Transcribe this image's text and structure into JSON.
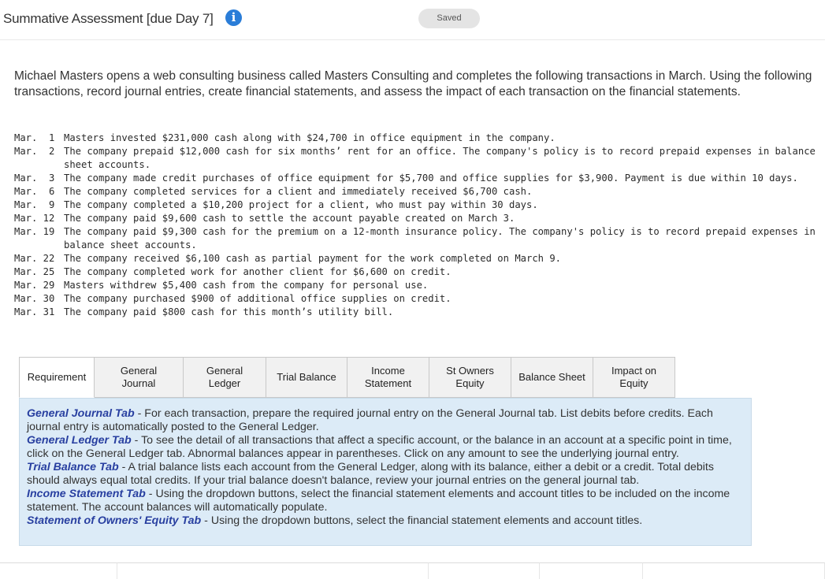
{
  "header": {
    "title": "Summative Assessment [due Day 7]",
    "info_icon": "i",
    "saved_label": "Saved"
  },
  "intro": "Michael Masters opens a web consulting business called Masters Consulting and completes the following transactions in March. Using the following transactions, record journal entries, create financial statements, and assess the impact of each transaction on the financial statements.",
  "transactions": [
    {
      "date": "Mar.  1",
      "text": "Masters invested $231,000 cash along with $24,700 in office equipment in the company."
    },
    {
      "date": "Mar.  2",
      "text": "The company prepaid $12,000 cash for six months’ rent for an office. The company's policy is to record prepaid expenses in balance sheet accounts."
    },
    {
      "date": "Mar.  3",
      "text": "The company made credit purchases of office equipment for $5,700 and office supplies for $3,900. Payment is due within 10 days."
    },
    {
      "date": "Mar.  6",
      "text": "The company completed services for a client and immediately received $6,700 cash."
    },
    {
      "date": "Mar.  9",
      "text": "The company completed a $10,200 project for a client, who must pay within 30 days."
    },
    {
      "date": "Mar. 12",
      "text": "The company paid $9,600 cash to settle the account payable created on March 3."
    },
    {
      "date": "Mar. 19",
      "text": "The company paid $9,300 cash for the premium on a 12-month insurance policy. The company's policy is to record prepaid expenses in balance sheet accounts."
    },
    {
      "date": "Mar. 22",
      "text": "The company received $6,100 cash as partial payment for the work completed on March 9."
    },
    {
      "date": "Mar. 25",
      "text": "The company completed work for another client for $6,600 on credit."
    },
    {
      "date": "Mar. 29",
      "text": "Masters withdrew $5,400 cash from the company for personal use."
    },
    {
      "date": "Mar. 30",
      "text": "The company purchased $900 of additional office supplies on credit."
    },
    {
      "date": "Mar. 31",
      "text": "The company paid $800 cash for this month’s utility bill."
    }
  ],
  "tabs": [
    {
      "line1": "Requirement",
      "line2": ""
    },
    {
      "line1": "General",
      "line2": "Journal"
    },
    {
      "line1": "General",
      "line2": "Ledger"
    },
    {
      "line1": "Trial Balance",
      "line2": ""
    },
    {
      "line1": "Income",
      "line2": "Statement"
    },
    {
      "line1": "St Owners",
      "line2": "Equity"
    },
    {
      "line1": "Balance Sheet",
      "line2": ""
    },
    {
      "line1": "Impact on",
      "line2": "Equity"
    }
  ],
  "panel": {
    "items": [
      {
        "title": "General Journal Tab",
        "text": " - For each transaction, prepare the required journal entry on the General Journal tab.  List debits before credits.  Each journal entry is automatically posted to the General Ledger."
      },
      {
        "title": "General Ledger Tab",
        "text": " - To see the detail of all transactions that affect a specific account, or the balance in an account at a specific point in time, click on the General Ledger tab.  Abnormal balances appear in parentheses.  Click on any amount to see the underlying journal entry."
      },
      {
        "title": "Trial Balance Tab",
        "text": " - A trial balance lists each account from the General Ledger, along with its balance, either a debit or a credit.   Total debits should always equal total credits.  If your trial balance doesn't balance, review your journal entries on the general journal tab."
      },
      {
        "title": "Income Statement Tab",
        "text": "  - Using the dropdown buttons, select the financial statement elements and account titles to be included on the income statement.  The account balances will automatically populate."
      },
      {
        "title": "Statement of Owners' Equity Tab",
        "text": " - Using the dropdown buttons, select the financial statement elements and account titles."
      }
    ]
  }
}
